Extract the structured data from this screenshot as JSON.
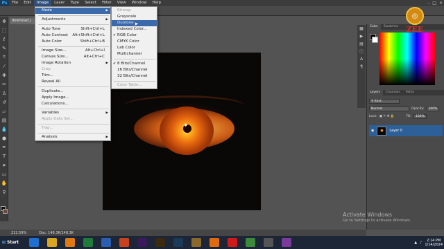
{
  "app": {
    "logo": "Ps"
  },
  "menubar": {
    "items": [
      "File",
      "Edit",
      "Image",
      "Layer",
      "Type",
      "Select",
      "Filter",
      "View",
      "Window",
      "Help"
    ],
    "active": "Image"
  },
  "document": {
    "tab_label": "download.j"
  },
  "image_menu": {
    "items": [
      {
        "label": "Mode",
        "highlight": true,
        "submenu": true
      },
      {
        "label": "Adjustments",
        "submenu": true
      },
      {
        "label": "Auto Tone",
        "shortcut": "Shift+Ctrl+L"
      },
      {
        "label": "Auto Contrast",
        "shortcut": "Alt+Shift+Ctrl+L"
      },
      {
        "label": "Auto Color",
        "shortcut": "Shift+Ctrl+B"
      },
      {
        "label": "Image Size...",
        "shortcut": "Alt+Ctrl+I"
      },
      {
        "label": "Canvas Size...",
        "shortcut": "Alt+Ctrl+C"
      },
      {
        "label": "Image Rotation",
        "submenu": true
      },
      {
        "label": "Crop",
        "disabled": true
      },
      {
        "label": "Trim..."
      },
      {
        "label": "Reveal All"
      },
      {
        "label": "Duplicate..."
      },
      {
        "label": "Apply Image..."
      },
      {
        "label": "Calculations..."
      },
      {
        "label": "Variables",
        "submenu": true
      },
      {
        "label": "Apply Data Set...",
        "disabled": true
      },
      {
        "label": "Trap...",
        "disabled": true
      },
      {
        "label": "Analysis",
        "submenu": true
      }
    ]
  },
  "mode_menu": {
    "items": [
      {
        "label": "Bitmap",
        "disabled": true
      },
      {
        "label": "Grayscale"
      },
      {
        "label": "Duotone",
        "disabled": true
      },
      {
        "label": "Indexed Color..."
      },
      {
        "label": "RGB Color",
        "checked": true
      },
      {
        "label": "CMYK Color"
      },
      {
        "label": "Lab Color"
      },
      {
        "label": "Multichannel"
      },
      {
        "label": "8 Bits/Channel",
        "checked": true
      },
      {
        "label": "16 Bits/Channel"
      },
      {
        "label": "32 Bits/Channel"
      },
      {
        "label": "Color Table...",
        "disabled": true
      }
    ]
  },
  "color_panel": {
    "tabs": [
      "Color",
      "Swatches"
    ]
  },
  "layers_panel": {
    "tabs": [
      "Layers",
      "Channels",
      "Paths"
    ],
    "kind_label": "Kind",
    "blend_mode": "Normal",
    "opacity_label": "Opacity:",
    "opacity_value": "100%",
    "lock_label": "Lock:",
    "fill_label": "Fill:",
    "fill_value": "100%",
    "layer_name": "Layer 0"
  },
  "logo": {
    "text": "ZEE"
  },
  "statusbar": {
    "zoom": "212.59%",
    "doc": "Doc: 148.3K/148.3K"
  },
  "watermark": {
    "title": "Activate Windows",
    "subtitle": "Go to Settings to activate Windows."
  },
  "taskbar": {
    "start_label": "Start",
    "apps": [
      {
        "icon": "ie-icon",
        "color": "#1f6fd0"
      },
      {
        "icon": "explorer-icon",
        "color": "#d9a520"
      },
      {
        "icon": "media-player-icon",
        "color": "#e07a10"
      },
      {
        "icon": "excel-icon",
        "color": "#1e7b3a"
      },
      {
        "icon": "word-icon",
        "color": "#2b5eb0"
      },
      {
        "icon": "powerpoint-icon",
        "color": "#c8421e"
      },
      {
        "icon": "premiere-icon",
        "color": "#3a1a5a"
      },
      {
        "icon": "illustrator-icon",
        "color": "#3a2a10"
      },
      {
        "icon": "photoshop-icon",
        "color": "#1b3a57"
      },
      {
        "icon": "app-icon",
        "color": "#8a6a2a"
      },
      {
        "icon": "firefox-icon",
        "color": "#e06a10"
      },
      {
        "icon": "opera-icon",
        "color": "#d01a1a"
      },
      {
        "icon": "chrome-icon",
        "color": "#3a8a3a"
      },
      {
        "icon": "app2-icon",
        "color": "#555555"
      },
      {
        "icon": "app3-icon",
        "color": "#7a3a9a"
      }
    ],
    "time": "2:14 PM",
    "date": "1/14/2024"
  }
}
